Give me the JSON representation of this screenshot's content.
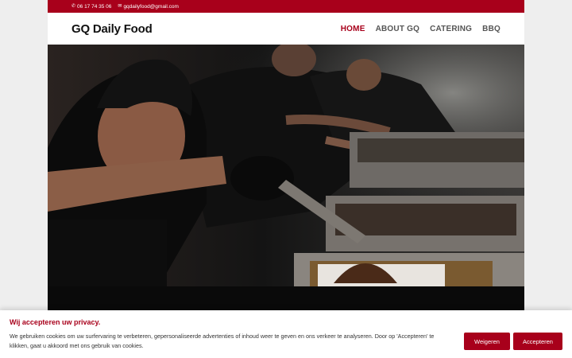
{
  "topbar": {
    "phone": "06 17 74 35 06",
    "email": "gqdailyfood@gmail.com",
    "phone_icon": "phone-icon",
    "email_icon": "envelope-icon"
  },
  "header": {
    "logo": "GQ Daily Food",
    "nav": [
      {
        "label": "HOME",
        "active": true
      },
      {
        "label": "ABOUT GQ",
        "active": false
      },
      {
        "label": "CATERING",
        "active": false
      },
      {
        "label": "BBQ",
        "active": false
      }
    ]
  },
  "cookie": {
    "title": "Wij accepteren uw privacy.",
    "text": "We gebruiken cookies om uw surfervaring te verbeteren, gepersonaliseerde advertenties of inhoud weer te geven en ons verkeer te analyseren. Door op 'Accepteren' te klikken, gaat u akkoord met ons gebruik van cookies.",
    "decline_label": "Weigeren",
    "accept_label": "Accepteren"
  },
  "colors": {
    "brand": "#a8001b",
    "background": "#eeeeee"
  }
}
